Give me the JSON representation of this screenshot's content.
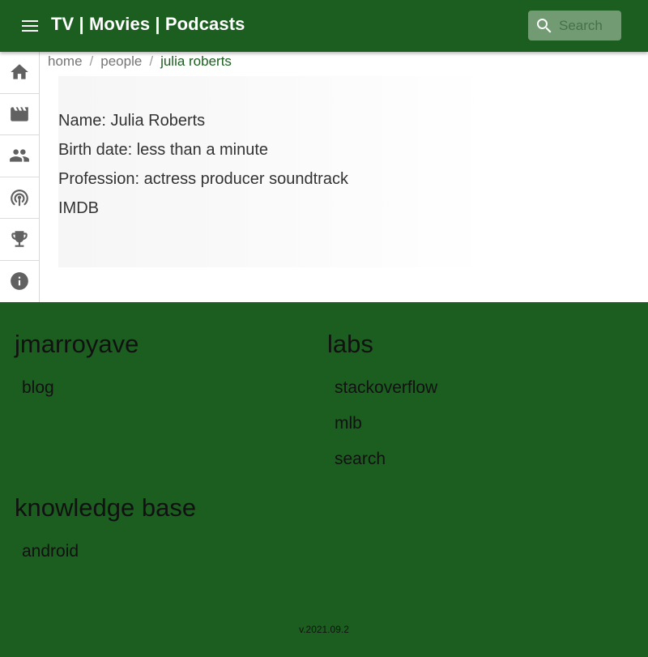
{
  "header": {
    "title": "TV | Movies | Podcasts",
    "menu_icon": "menu-icon",
    "search": {
      "placeholder": "Search",
      "value": "",
      "icon": "search-icon"
    }
  },
  "siderail": {
    "items": [
      {
        "icon": "home-icon"
      },
      {
        "icon": "movie-icon"
      },
      {
        "icon": "people-icon"
      },
      {
        "icon": "podcast-icon"
      },
      {
        "icon": "trophy-icon"
      },
      {
        "icon": "info-icon"
      }
    ]
  },
  "breadcrumb": {
    "items": [
      "home",
      "people"
    ],
    "separator": "/",
    "current": "julia roberts"
  },
  "person": {
    "name_line": "Name: Julia Roberts",
    "birth_line": "Birth date: less than a minute",
    "profession_line": "Profession: actress producer soundtrack",
    "imdb_label": "IMDB"
  },
  "footer": {
    "sections": [
      {
        "title": "jmarroyave",
        "links": [
          "blog"
        ]
      },
      {
        "title": "labs",
        "links": [
          "stackoverflow",
          "mlb",
          "search"
        ]
      },
      {
        "title": "knowledge base",
        "links": [
          "android"
        ]
      }
    ],
    "version": "v.2021.09.2"
  },
  "colors": {
    "primary": "#1c5e20",
    "icon_gray": "#616161",
    "breadcrumb_active": "#1c5e20"
  }
}
